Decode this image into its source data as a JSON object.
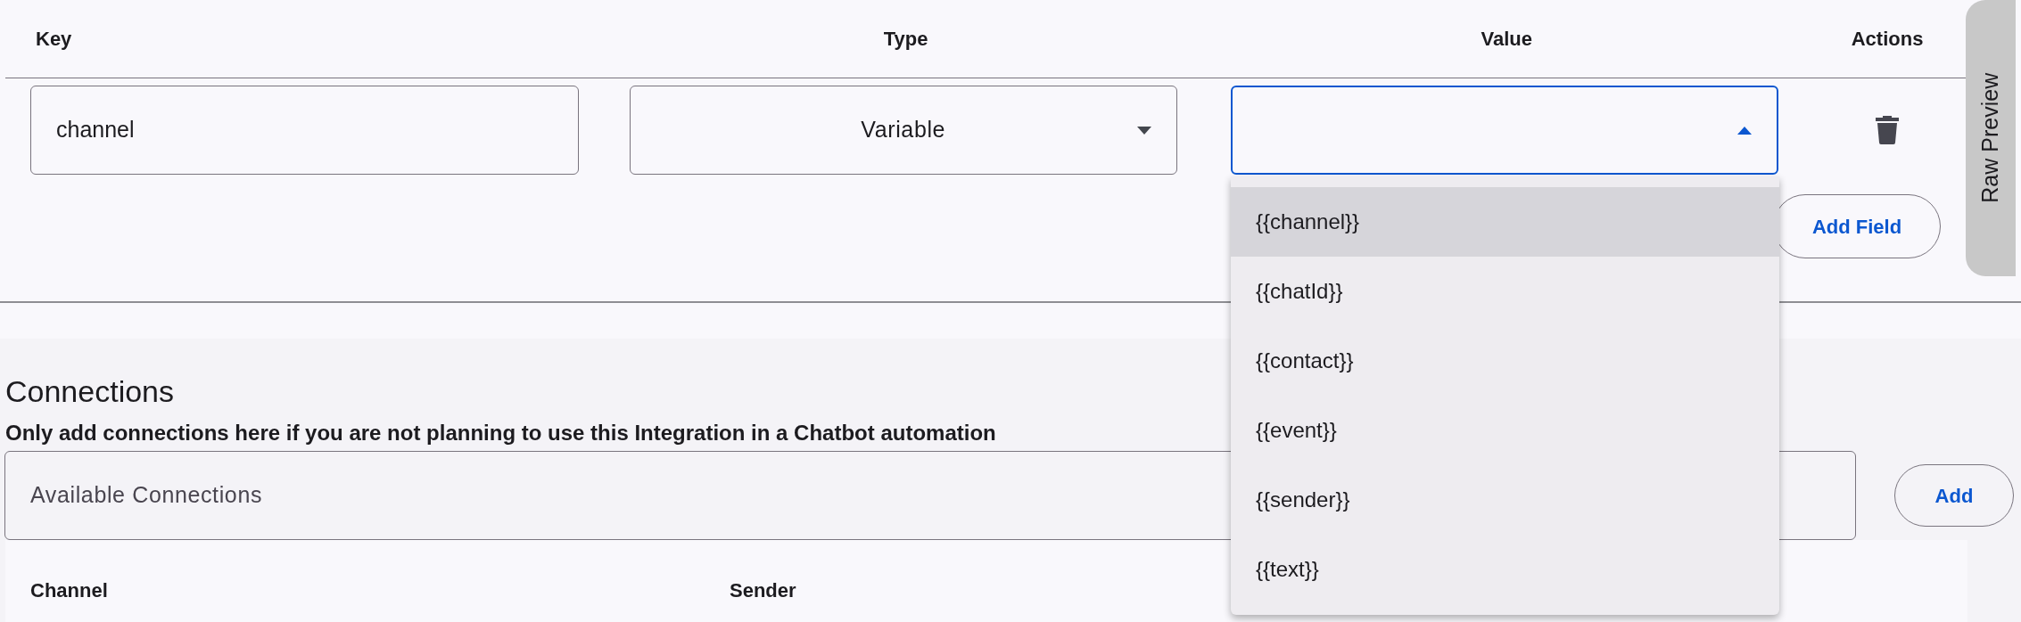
{
  "fields_table": {
    "columns": [
      "Key",
      "Type",
      "Value",
      "Actions"
    ],
    "rows": [
      {
        "key": "channel",
        "type": "Variable",
        "value": {
          "expanded": true,
          "options": [
            {
              "label": "{{channel}}",
              "selected": true
            },
            {
              "label": "{{chatId}}",
              "selected": false
            },
            {
              "label": "{{contact}}",
              "selected": false
            },
            {
              "label": "{{event}}",
              "selected": false
            },
            {
              "label": "{{sender}}",
              "selected": false
            },
            {
              "label": "{{text}}",
              "selected": false
            }
          ]
        }
      }
    ],
    "add_button": "Add Field"
  },
  "raw_preview_tab": "Raw Preview",
  "connections": {
    "title": "Connections",
    "subtitle": "Only add connections here if you are not planning to use this Integration in a Chatbot automation",
    "select": {
      "placeholder": "Available Connections"
    },
    "add_button": "Add",
    "table": {
      "columns": [
        "Channel",
        "Sender"
      ]
    }
  }
}
